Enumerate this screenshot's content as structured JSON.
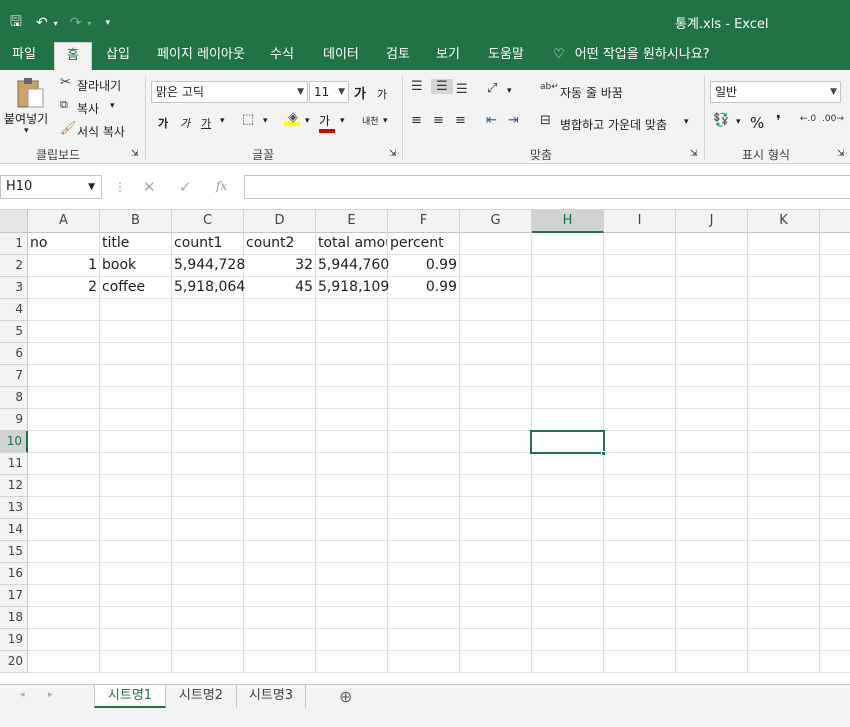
{
  "window": {
    "title": "통계.xls  -  Excel"
  },
  "qat": {
    "save_icon": "save-icon",
    "undo_icon": "undo-icon",
    "redo_icon": "redo-icon",
    "customize_icon": "customize-icon"
  },
  "menu": {
    "tabs": [
      "파일",
      "홈",
      "삽입",
      "페이지 레이아웃",
      "수식",
      "데이터",
      "검토",
      "보기",
      "도움말"
    ],
    "active": "홈",
    "tellme": "어떤 작업을 원하시나요?"
  },
  "ribbon": {
    "clipboard": {
      "paste": "붙여넣기",
      "cut": "잘라내기",
      "copy": "복사",
      "format_painter": "서식 복사",
      "label": "클립보드"
    },
    "font": {
      "name": "맑은 고딕",
      "size": "11",
      "grow": "가",
      "shrink": "가",
      "bold": "가",
      "italic": "가",
      "underline": "가",
      "phonetic": "내천",
      "font_color": "가",
      "label": "글꼴"
    },
    "alignment": {
      "wrap": "자동 줄 바꿈",
      "merge": "병합하고 가운데 맞춤",
      "label": "맞춤"
    },
    "number": {
      "format": "일반",
      "percent": "%",
      "label": "표시 형식"
    }
  },
  "formula": {
    "namebox": "H10",
    "fx": "fx",
    "content": ""
  },
  "grid": {
    "columns": [
      "A",
      "B",
      "C",
      "D",
      "E",
      "F",
      "G",
      "H",
      "I",
      "J",
      "K"
    ],
    "selected_column": "H",
    "rows": [
      "1",
      "2",
      "3",
      "4",
      "5",
      "6",
      "7",
      "8",
      "9",
      "10",
      "11",
      "12",
      "13",
      "14",
      "15",
      "16",
      "17",
      "18",
      "19",
      "20"
    ],
    "selected_row": "10",
    "data": [
      [
        "no",
        "title",
        "count1",
        "count2",
        "total amount",
        "percent"
      ],
      [
        "1",
        "book",
        "5,944,728",
        "32",
        "5,944,760",
        "0.99"
      ],
      [
        "2",
        "coffee",
        "5,918,064",
        "45",
        "5,918,109",
        "0.99"
      ]
    ],
    "header_display": {
      "E": "total amou"
    }
  },
  "sheets": {
    "tabs": [
      "시트명1",
      "시트명2",
      "시트명3"
    ],
    "active": "시트명1",
    "add_icon": "add-sheet-icon"
  }
}
